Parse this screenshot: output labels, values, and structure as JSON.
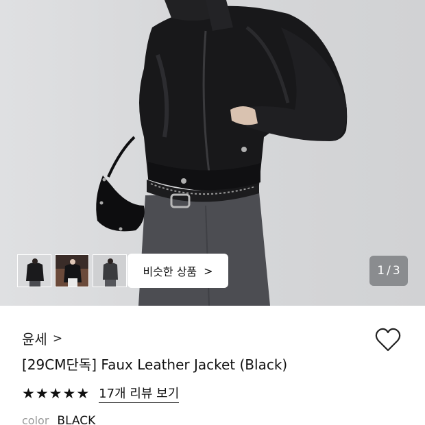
{
  "gallery": {
    "similar_button_label": "비슷한 상품",
    "similar_button_chevron": ">",
    "pager": {
      "current": "1",
      "separator": "/",
      "total": "3"
    },
    "thumbnails": [
      "thumbnail-1",
      "thumbnail-2",
      "thumbnail-3"
    ]
  },
  "product": {
    "brand": "윤세",
    "brand_chevron": ">",
    "title": "[29CM단독] Faux Leather Jacket (Black)",
    "rating_stars": 5,
    "reviews_link": "17개 리뷰 보기",
    "color_label": "color",
    "color_value": "BLACK"
  },
  "icons": {
    "wishlist": "heart-outline-icon",
    "star": "star-icon",
    "chevron": "chevron-right-icon"
  },
  "colors": {
    "text_primary": "#111111",
    "text_muted": "#999999",
    "pager_bg": "#6e7074"
  }
}
